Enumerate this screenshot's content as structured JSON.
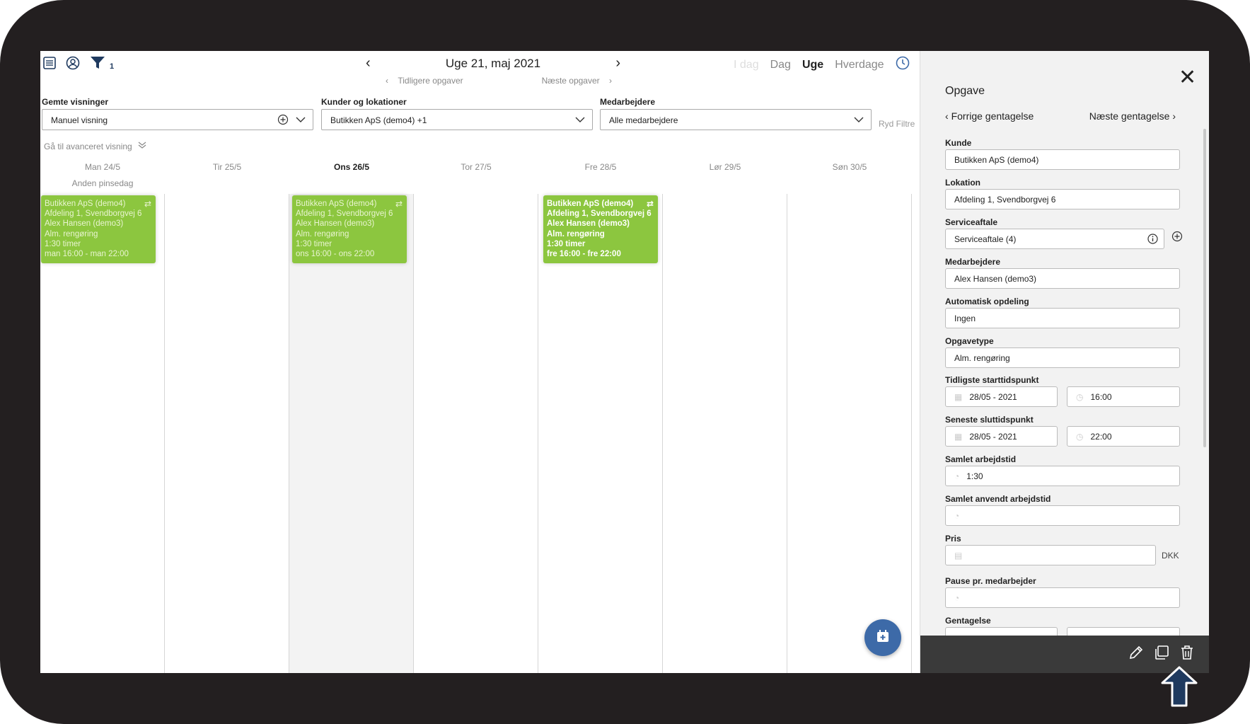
{
  "toolbar": {
    "filter_count": "1"
  },
  "week": {
    "title": "Uge 21, maj 2021",
    "prev_tasks": "Tidligere opgaver",
    "next_tasks": "Næste opgaver"
  },
  "views": {
    "idag": "I dag",
    "dag": "Dag",
    "uge": "Uge",
    "hverdage": "Hverdage",
    "active": "Uge"
  },
  "filters": {
    "saved_views_label": "Gemte visninger",
    "saved_views_value": "Manuel visning",
    "customers_label": "Kunder og lokationer",
    "customers_value": "Butikken ApS (demo4) +1",
    "employees_label": "Medarbejdere",
    "employees_value": "Alle medarbejdere",
    "clear": "Ryd Filtre",
    "advanced": "Gå til avanceret visning"
  },
  "days": [
    {
      "label": "Man 24/5",
      "today": false
    },
    {
      "label": "Tir 25/5",
      "today": false
    },
    {
      "label": "Ons 26/5",
      "today": true
    },
    {
      "label": "Tor 27/5",
      "today": false
    },
    {
      "label": "Fre 28/5",
      "today": false
    },
    {
      "label": "Lør 29/5",
      "today": false
    },
    {
      "label": "Søn 30/5",
      "today": false
    }
  ],
  "holiday": "Anden pinsedag",
  "events": [
    {
      "customer": "Butikken ApS (demo4)",
      "location": "Afdeling 1, Svendborgvej 6",
      "employee": "Alex Hansen (demo3)",
      "type": "Alm. rengøring",
      "duration": "1:30 timer",
      "time": "man 16:00 - man 22:00"
    },
    {
      "customer": "Butikken ApS (demo4)",
      "location": "Afdeling 1, Svendborgvej 6",
      "employee": "Alex Hansen (demo3)",
      "type": "Alm. rengøring",
      "duration": "1:30 timer",
      "time": "ons 16:00 - ons 22:00"
    },
    {
      "customer": "Butikken ApS (demo4)",
      "location": "Afdeling 1, Svendborgvej 6",
      "employee": "Alex Hansen (demo3)",
      "type": "Alm. rengøring",
      "duration": "1:30 timer",
      "time": "fre 16:00 - fre 22:00"
    }
  ],
  "panel": {
    "title": "Opgave",
    "prev_rec": "Forrige gentagelse",
    "next_rec": "Næste gentagelse",
    "kunde_label": "Kunde",
    "kunde": "Butikken ApS (demo4)",
    "lokation_label": "Lokation",
    "lokation": "Afdeling 1, Svendborgvej 6",
    "serviceaftale_label": "Serviceaftale",
    "serviceaftale": "Serviceaftale (4)",
    "medarbejdere_label": "Medarbejdere",
    "medarbejdere": "Alex Hansen (demo3)",
    "opdeling_label": "Automatisk opdeling",
    "opdeling": "Ingen",
    "opgavetype_label": "Opgavetype",
    "opgavetype": "Alm. rengøring",
    "start_label": "Tidligste starttidspunkt",
    "start_date": "28/05 - 2021",
    "start_time": "16:00",
    "end_label": "Seneste sluttidspunkt",
    "end_date": "28/05 - 2021",
    "end_time": "22:00",
    "arbejdstid_label": "Samlet arbejdstid",
    "arbejdstid": "1:30",
    "anvendt_label": "Samlet anvendt arbejdstid",
    "anvendt": "",
    "pris_label": "Pris",
    "pris": "",
    "currency": "DKK",
    "pause_label": "Pause pr. medarbejder",
    "pause": "",
    "gentagelse_label": "Gentagelse"
  }
}
